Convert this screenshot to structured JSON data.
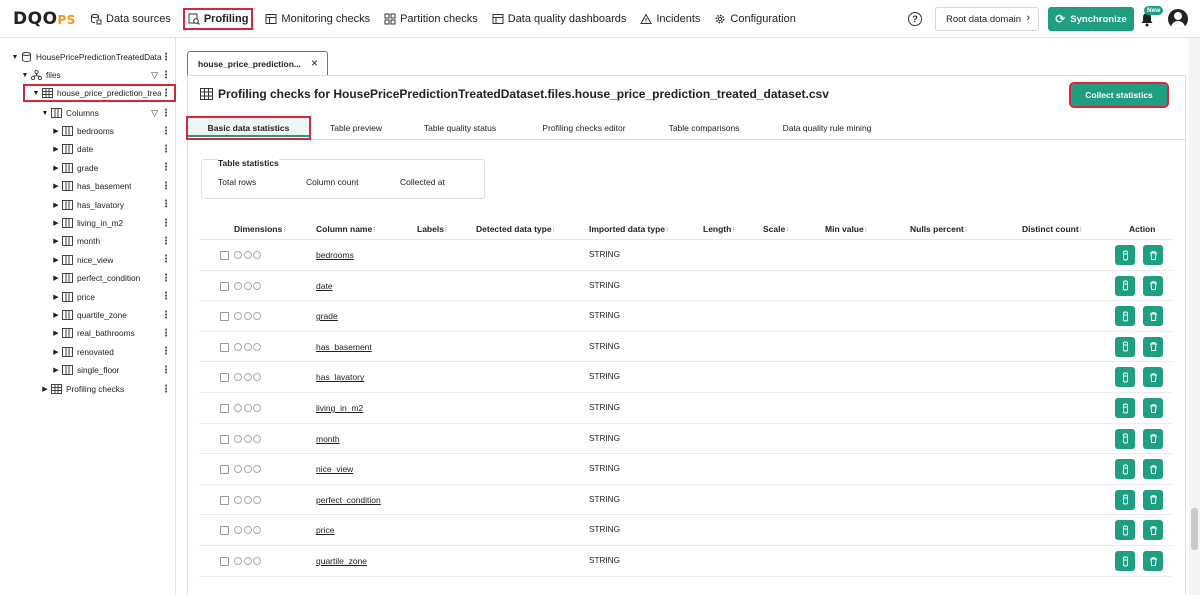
{
  "brand": {
    "logo_main": "DQO",
    "logo_suffix": "PS"
  },
  "nav": {
    "items": [
      {
        "label": "Data sources",
        "icon": "data-sources-icon"
      },
      {
        "label": "Profiling",
        "icon": "profiling-icon",
        "active": true
      },
      {
        "label": "Monitoring checks",
        "icon": "monitoring-icon"
      },
      {
        "label": "Partition checks",
        "icon": "partition-icon"
      },
      {
        "label": "Data quality dashboards",
        "icon": "dashboard-icon"
      },
      {
        "label": "Incidents",
        "icon": "warning-icon"
      },
      {
        "label": "Configuration",
        "icon": "gear-icon"
      }
    ],
    "help": "?",
    "domain_label": "Root data domain",
    "sync_label": "Synchronize",
    "new_badge": "New"
  },
  "tree": {
    "connection": "HousePricePredictionTreatedData",
    "schema": "files",
    "table": "house_price_prediction_treat",
    "columns_label": "Columns",
    "columns": [
      "bedrooms",
      "date",
      "grade",
      "has_basement",
      "has_lavatory",
      "living_in_m2",
      "month",
      "nice_view",
      "perfect_condition",
      "price",
      "quartile_zone",
      "real_bathrooms",
      "renovated",
      "single_floor"
    ],
    "profiling_checks": "Profiling checks"
  },
  "main": {
    "doc_tab": "house_price_prediction...",
    "title": "Profiling checks for HousePricePredictionTreatedDataset.files.house_price_prediction_treated_dataset.csv",
    "collect_label": "Collect statistics",
    "tabs": [
      "Basic data statistics",
      "Table preview",
      "Table quality status",
      "Profiling checks editor",
      "Table comparisons",
      "Data quality rule mining"
    ],
    "stats": {
      "title": "Table statistics",
      "total_rows": "Total rows",
      "column_count": "Column count",
      "collected_at": "Collected at"
    },
    "table": {
      "headers": [
        "Dimensions",
        "Column name",
        "Labels",
        "Detected data type",
        "Imported data type",
        "Length",
        "Scale",
        "Min value",
        "Nulls percent",
        "Distinct count",
        "Action"
      ],
      "rows": [
        {
          "name": "bedrooms",
          "imported": "STRING"
        },
        {
          "name": "date",
          "imported": "STRING"
        },
        {
          "name": "grade",
          "imported": "STRING"
        },
        {
          "name": "has_basement",
          "imported": "STRING"
        },
        {
          "name": "has_lavatory",
          "imported": "STRING"
        },
        {
          "name": "living_in_m2",
          "imported": "STRING"
        },
        {
          "name": "month",
          "imported": "STRING"
        },
        {
          "name": "nice_view",
          "imported": "STRING"
        },
        {
          "name": "perfect_condition",
          "imported": "STRING"
        },
        {
          "name": "price",
          "imported": "STRING"
        },
        {
          "name": "quartile_zone",
          "imported": "STRING"
        }
      ]
    }
  },
  "colors": {
    "accent": "#1f9e82",
    "highlight": "#d7263d",
    "logo_suffix": "#f39a1c"
  }
}
